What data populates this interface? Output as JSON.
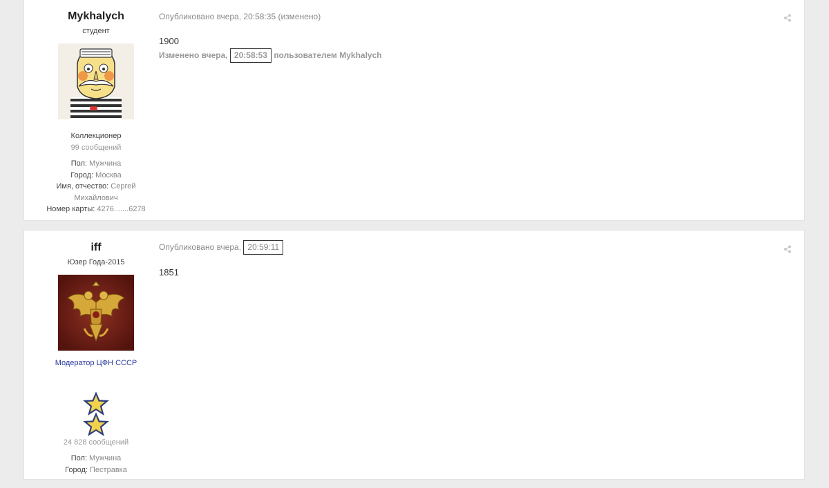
{
  "posts": [
    {
      "author": {
        "name": "Mykhalych",
        "title": "студент",
        "rank": "Коллекционер",
        "posts_count": "99 сообщений",
        "fields": [
          {
            "key": "Пол:",
            "value": "Мужчина"
          },
          {
            "key": "Город:",
            "value": "Москва"
          },
          {
            "key": "Имя, отчество:",
            "value": "Сергей Михайлович"
          },
          {
            "key": "Номер карты:",
            "value": "4276.......6278"
          }
        ]
      },
      "meta_prefix": "Опубликовано вчера,",
      "time": "20:58:35",
      "edited_suffix": "(изменено)",
      "body": "1900",
      "edit_note_prefix": "Изменено вчера,",
      "edit_time": "20:58:53",
      "edit_note_suffix": "пользователем Mykhalych"
    },
    {
      "author": {
        "name": "iff",
        "title": "Юзер Года-2015",
        "group": "Модератор ЦФН СССР",
        "posts_count": "24 828 сообщений",
        "fields": [
          {
            "key": "Пол:",
            "value": "Мужчина"
          },
          {
            "key": "Город:",
            "value": "Пестравка"
          }
        ]
      },
      "meta_prefix": "Опубликовано вчера,",
      "time": "20:59:11",
      "body": "1851"
    }
  ],
  "icons": {
    "share": "share-icon",
    "avatar1": "sailor-cat-avatar",
    "avatar2": "double-headed-eagle-avatar",
    "stars": "rank-stars-icon"
  },
  "colors": {
    "moderator": "#2a3a9c",
    "star_fill": "#f2d24b",
    "star_stroke": "#2e3f7d"
  }
}
